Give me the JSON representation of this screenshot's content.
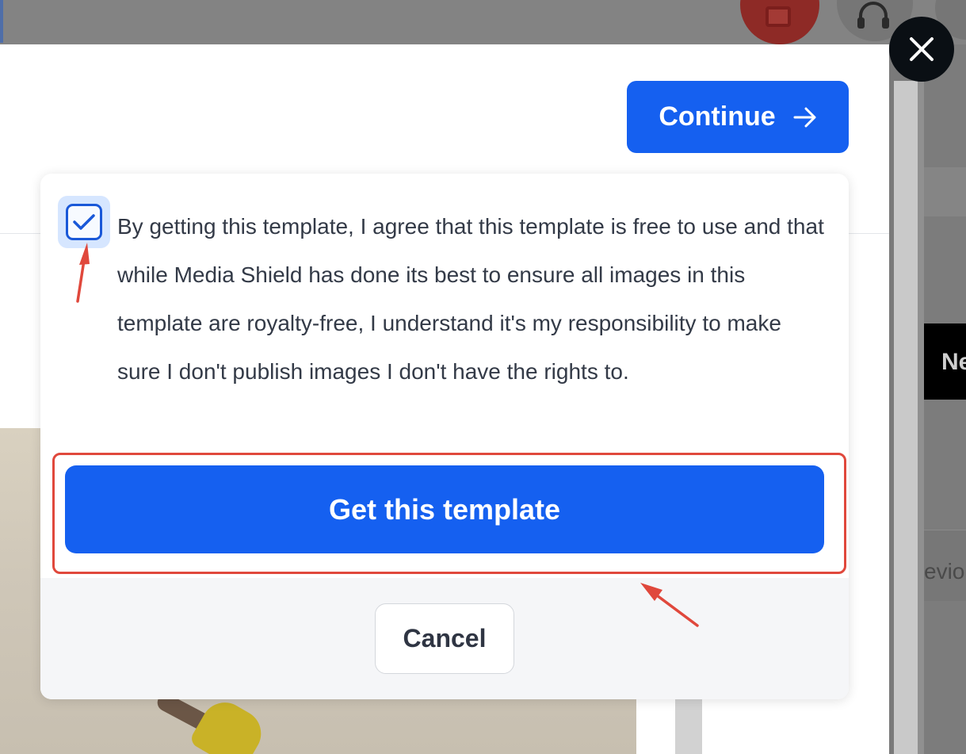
{
  "background": {
    "right_partial_label_1": "Ne",
    "right_partial_label_2": "evio"
  },
  "toolbar": {
    "continue_label": "Continue"
  },
  "consent": {
    "checked": true,
    "text": "By getting this template, I agree that this template is free to use and that while Media Shield has done its best to ensure all images in this template are royalty-free, I understand it's my responsibility to make sure I don't publish images I don't have the rights to."
  },
  "actions": {
    "get_template_label": "Get this template",
    "cancel_label": "Cancel"
  },
  "colors": {
    "primary": "#1560f0",
    "annotation": "#e0483c",
    "checkbox_bg": "#d6e6ff"
  },
  "icons": [
    "close-icon",
    "arrow-right-icon",
    "checkmark-icon",
    "ticket-icon",
    "headset-icon"
  ]
}
